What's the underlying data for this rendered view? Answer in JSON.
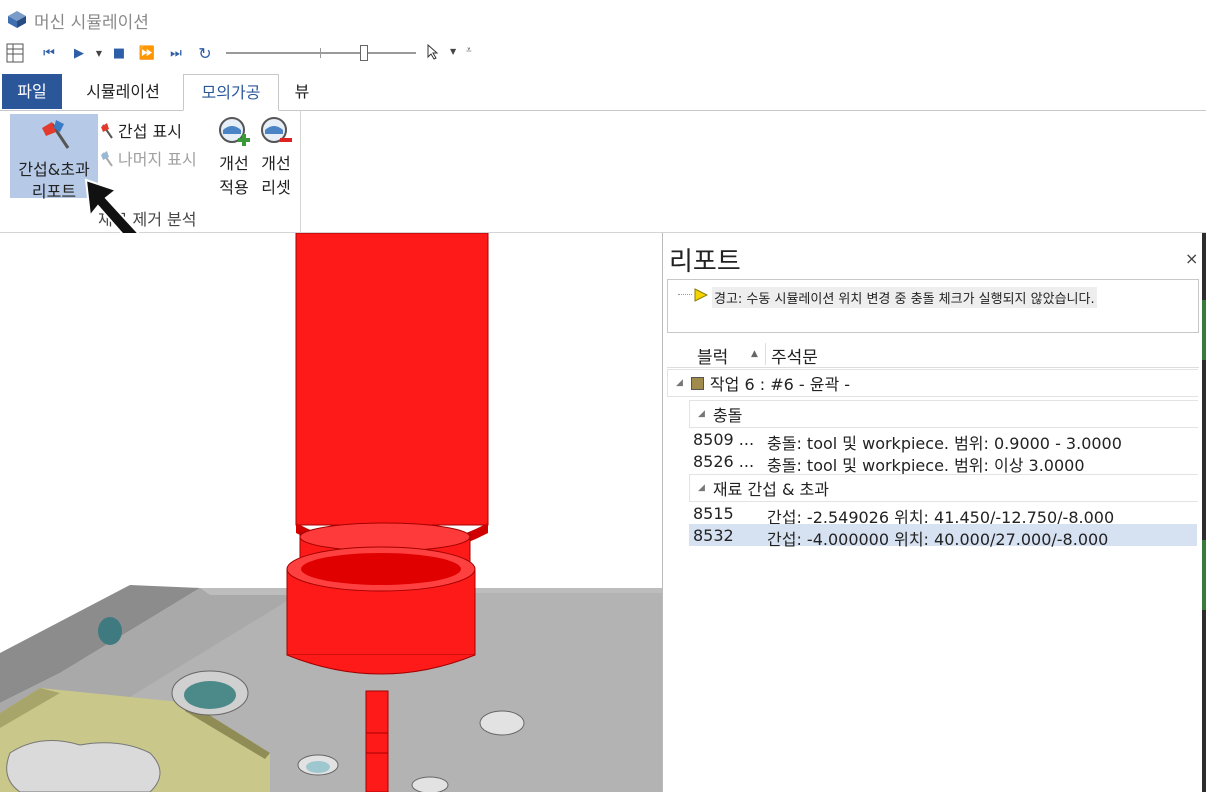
{
  "window": {
    "title": "머신 시뮬레이션"
  },
  "toolbar": {
    "icons": [
      "spreadsheet-icon",
      "skip-start-icon",
      "play-icon",
      "dropdown-icon",
      "stop-icon",
      "step-forward-icon",
      "skip-end-icon",
      "repeat-icon",
      "pointer-icon",
      "dropdown-icon",
      "more-icon"
    ]
  },
  "tabs": [
    {
      "id": "file",
      "label": "파일"
    },
    {
      "id": "sim",
      "label": "시뮬레이션"
    },
    {
      "id": "mock",
      "label": "모의가공",
      "active": true
    },
    {
      "id": "view",
      "label": "뷰"
    }
  ],
  "ribbon": {
    "big_button": {
      "line1": "간섭&초과",
      "line2": "리포트"
    },
    "show_interference": "간섭 표시",
    "show_remaining": "나머지 표시",
    "apply_improve": {
      "line1": "개선",
      "line2": "적용"
    },
    "reset_improve": {
      "line1": "개선",
      "line2": "리셋"
    },
    "group_label": "재료 제거 분석"
  },
  "report": {
    "title": "리포트",
    "close": "×",
    "warning": "경고: 수동 시뮬레이션 위치 변경 중 충돌 체크가 실행되지 않았습니다.",
    "columns": {
      "block": "블럭",
      "comment": "주석문"
    },
    "job": "작업 6 : #6 - 윤곽 -",
    "collision_group": "충돌",
    "collisions": [
      {
        "block": "8509 ...",
        "comment": "충돌: tool 및 workpiece. 범위: 0.9000 - 3.0000"
      },
      {
        "block": "8526 ...",
        "comment": "충돌: tool 및 workpiece. 범위: 이상 3.0000"
      }
    ],
    "interference_group": "재료 간섭 & 초과",
    "interferences": [
      {
        "block": "8515",
        "comment": "간섭: -2.549026  위치: 41.450/-12.750/-8.000"
      },
      {
        "block": "8532",
        "comment": "간섭: -4.000000  위치: 40.000/27.000/-8.000",
        "selected": true
      }
    ]
  },
  "colors": {
    "accent": "#2b579a",
    "tool_red": "#ff1a1a",
    "selection": "#d6e2f1"
  }
}
